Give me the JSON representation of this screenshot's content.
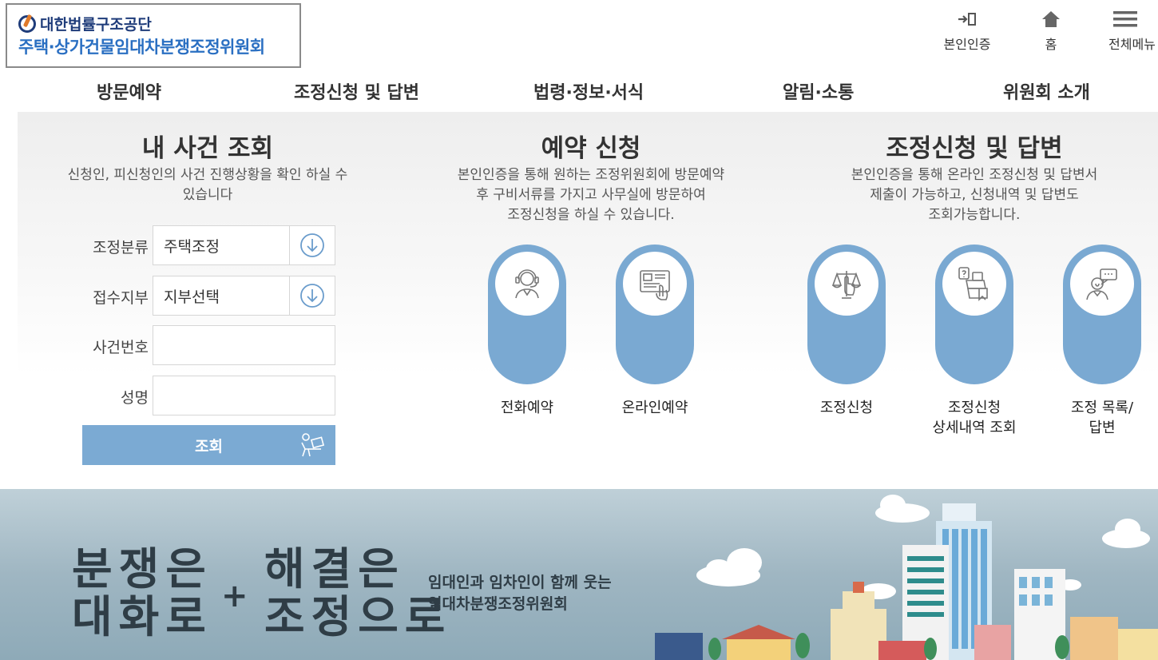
{
  "header": {
    "org_name": "대한법률구조공단",
    "committee_name": "주택·상가건물임대차분쟁조정위원회",
    "util": {
      "auth": "본인인증",
      "home": "홈",
      "menu": "전체메뉴"
    }
  },
  "nav": [
    "방문예약",
    "조정신청 및 답변",
    "법령·정보·서식",
    "알림·소통",
    "위원회 소개"
  ],
  "case_lookup": {
    "title": "내 사건 조회",
    "desc_line1": "신청인, 피신청인의 사건 진행상황을 확인 하실 수",
    "desc_line2": "있습니다",
    "fields": {
      "category_label": "조정분류",
      "category_value": "주택조정",
      "branch_label": "접수지부",
      "branch_value": "지부선택",
      "case_no_label": "사건번호",
      "name_label": "성명"
    },
    "submit": "조회"
  },
  "reservation": {
    "title": "예약 신청",
    "desc_line1": "본인인증을 통해 원하는 조정위원회에 방문예약",
    "desc_line2": "후 구비서류를 가지고 사무실에 방문하여",
    "desc_line3": "조정신청을 하실 수 있습니다.",
    "items": [
      {
        "label": "전화예약",
        "icon": "headset-person-icon"
      },
      {
        "label": "온라인예약",
        "icon": "online-form-icon"
      }
    ]
  },
  "mediation": {
    "title": "조정신청 및 답변",
    "desc_line1": "본인인증을 통해 온라인 조정신청 및 답변서",
    "desc_line2": "제출이 가능하고, 신청내역 및 답변도",
    "desc_line3": "조회가능합니다.",
    "items": [
      {
        "label_line1": "조정신청",
        "label_line2": "",
        "icon": "scales-hand-icon"
      },
      {
        "label_line1": "조정신청",
        "label_line2": "상세내역 조회",
        "icon": "search-document-icon"
      },
      {
        "label_line1": "조정 목록/",
        "label_line2": "답변",
        "icon": "speech-person-icon"
      }
    ]
  },
  "banner": {
    "slogan_a_line1": "분쟁은",
    "slogan_a_line2": "대화로",
    "plus": "+",
    "slogan_b_line1": "해결은",
    "slogan_b_line2": "조정으로",
    "sub_line1": "임대인과 임차인이 함께 웃는",
    "sub_line2": "임대차분쟁조정위원회"
  },
  "colors": {
    "accent": "#7aa9d2",
    "brand_dark": "#1f3c7a",
    "brand_blue": "#2a6fc2"
  }
}
